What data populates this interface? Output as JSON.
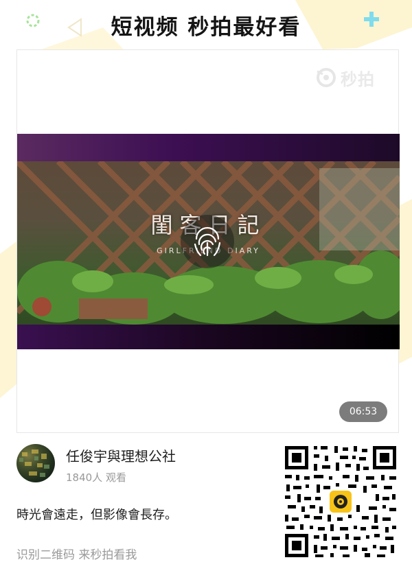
{
  "header": {
    "title": "短视频 秒拍最好看"
  },
  "watermark": {
    "logo_text": "秒拍"
  },
  "video": {
    "title": "閨客日記",
    "subtitle": "GIRLFRIEND DIARY",
    "duration": "06:53",
    "play_icon": "fingerprint-icon"
  },
  "author": {
    "name": "任俊宇與理想公社",
    "watch_count": "1840人 观看"
  },
  "post": {
    "description": "時光會遠走，但影像會長存。"
  },
  "footer": {
    "qr_hint": "识别二维码 来秒拍看我"
  },
  "colors": {
    "accent_yellow": "#f7c318",
    "deco_cyan": "#5fd4e8",
    "deco_green": "#9bdc8a"
  }
}
